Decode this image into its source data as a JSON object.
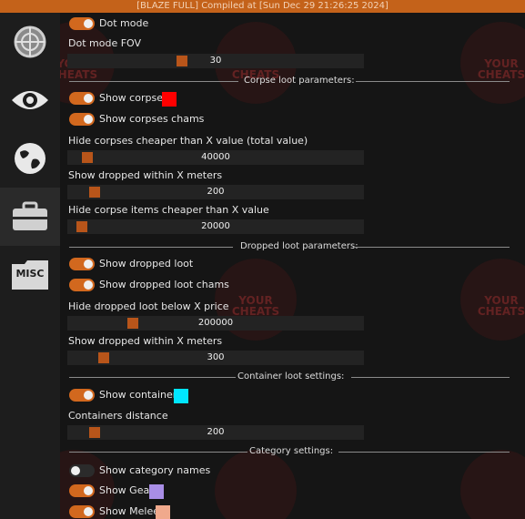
{
  "titlebar": {
    "text": "[BLAZE FULL] Compiled at [Sun Dec 29 21:26:25 2024]"
  },
  "sidebar": {
    "items": [
      {
        "icon": "crosshair-icon",
        "active": false
      },
      {
        "icon": "eye-icon",
        "active": false
      },
      {
        "icon": "globe-icon",
        "active": false
      },
      {
        "icon": "briefcase-icon",
        "active": true
      },
      {
        "icon": "misc-folder-icon",
        "label": "MISC",
        "active": false
      }
    ]
  },
  "watermark": {
    "text": "YOUR CHEATS"
  },
  "settings": {
    "dot_mode": {
      "label": "Dot mode",
      "on": true
    },
    "dot_fov": {
      "label": "Dot mode FOV",
      "value": "30",
      "fraction": 0.37
    },
    "corpse_section": "Corpse loot parameters:",
    "show_corpses": {
      "label": "Show corpses",
      "on": true,
      "color": "#ff0000"
    },
    "show_corpses_chams": {
      "label": "Show corpses chams",
      "on": true
    },
    "hide_corpses_cheaper": {
      "label": "Hide corpses cheaper than X value (total value)",
      "value": "40000",
      "fraction": 0.06
    },
    "show_dropped_within_1": {
      "label": "Show dropped within X meters",
      "value": "200",
      "fraction": 0.08
    },
    "hide_corpse_items": {
      "label": "Hide corpse items cheaper than X value",
      "value": "20000",
      "fraction": 0.04
    },
    "dropped_section": "Dropped loot parameters:",
    "show_dropped_loot": {
      "label": "Show dropped loot",
      "on": true
    },
    "show_dropped_loot_chams": {
      "label": "Show dropped loot chams",
      "on": true
    },
    "hide_dropped_below": {
      "label": "Hide dropped loot below X price",
      "value": "200000",
      "fraction": 0.21
    },
    "show_dropped_within_2": {
      "label": "Show dropped within X meters",
      "value": "300",
      "fraction": 0.11
    },
    "container_section": "Container loot settings:",
    "show_containers": {
      "label": "Show containers",
      "on": true,
      "color": "#00e5ff"
    },
    "containers_distance": {
      "label": "Containers distance",
      "value": "200",
      "fraction": 0.08
    },
    "category_section": "Category settings:",
    "show_category_names": {
      "label": "Show category names",
      "on": false
    },
    "show_gear": {
      "label": "Show Gear",
      "on": true,
      "color": "#a98ee6"
    },
    "show_melee": {
      "label": "Show Melee",
      "on": true,
      "color": "#f0a98c"
    }
  }
}
